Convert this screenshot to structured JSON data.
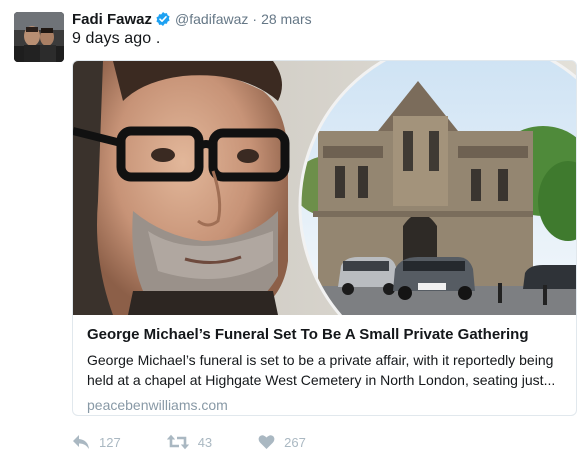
{
  "tweet": {
    "author_name": "Fadi Fawaz",
    "author_handle": "@fadifawaz",
    "separator": "·",
    "date": "28 mars",
    "text": "9 days ago ."
  },
  "card": {
    "title": "George Michael’s Funeral Set To Be A Small Private Gathering",
    "description": "George Michael’s funeral is set to be a private affair, with it reportedly being held at a chapel at Highgate West Cemetery in North London, seating just...",
    "domain": "peacebenwilliams.com",
    "image_alt": "George Michael portrait with Highgate Cemetery chapel",
    "car_plate": "EN14 ZYU"
  },
  "actions": {
    "reply": {
      "icon": "reply-icon",
      "count": "127"
    },
    "retweet": {
      "icon": "retweet-icon",
      "count": "43"
    },
    "like": {
      "icon": "heart-icon",
      "count": "267"
    }
  },
  "colors": {
    "verified": "#1da1f2",
    "muted_text": "#657786",
    "action_icon": "#aab8c2",
    "card_border": "#e1e8ed"
  }
}
